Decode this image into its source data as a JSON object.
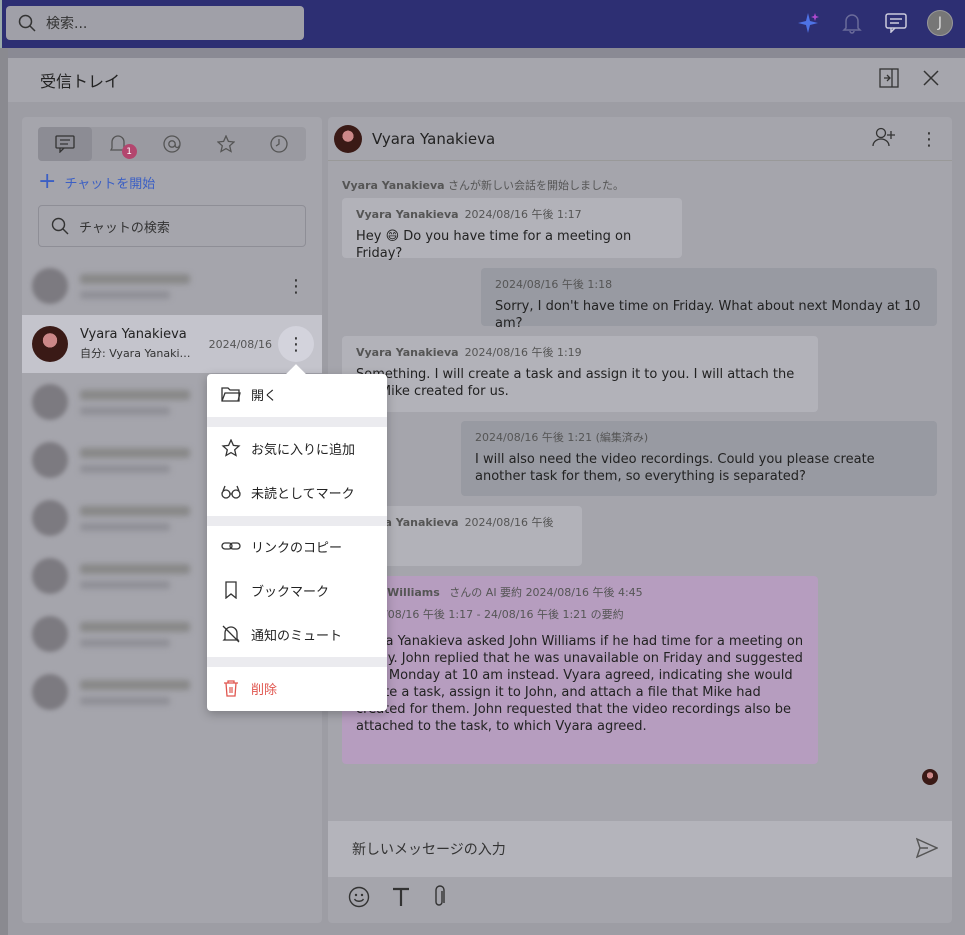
{
  "topbar": {
    "search_placeholder": "検索...",
    "avatar_letter": "J",
    "icons": [
      "sparkle-icon",
      "bell-icon",
      "chat-icon"
    ]
  },
  "panel": {
    "title": "受信トレイ"
  },
  "sidebar": {
    "tabs": [
      "chat-icon",
      "bell-icon",
      "at-icon",
      "star-icon",
      "clock-icon"
    ],
    "notif_badge": "1",
    "start_chat": "チャットを開始",
    "search_placeholder": "チャットの検索",
    "selected": {
      "name": "Vyara Yanakieva",
      "preview": "自分: Vyara Yanakieva asked…",
      "date": "2024/08/16"
    }
  },
  "context_menu": {
    "open": "開く",
    "add_favorite": "お気に入りに追加",
    "mark_unread": "未読としてマーク",
    "copy_link": "リンクのコピー",
    "bookmark": "ブックマーク",
    "mute": "通知のミュート",
    "delete": "削除"
  },
  "chat": {
    "header_name": "Vyara Yanakieva",
    "system_name": "Vyara Yanakieva",
    "system_text": " さんが新しい会話を開始しました。",
    "messages": [
      {
        "author": "Vyara Yanakieva",
        "time": "2024/08/16 午後 1:17",
        "text": "Hey 😄 Do you have time for a meeting on Friday?"
      },
      {
        "time": "2024/08/16 午後 1:18",
        "text": "Sorry, I don't have time on Friday. What about next Monday at 10 am?"
      },
      {
        "author": "Vyara Yanakieva",
        "time": "2024/08/16 午後 1:19",
        "text": "Something. I will create a task and assign it to you. I will attach the file Mike created for us."
      },
      {
        "time": "2024/08/16 午後 1:21 (編集済み)",
        "text": "I will also need the video recordings. Could you please create another task for them, so everything is separated?"
      },
      {
        "author": "Vyara Yanakieva",
        "time": "2024/08/16 午後 1:21",
        "text": "😄"
      }
    ],
    "ai_summary": {
      "author": "John Williams",
      "author_suffix": " さんの AI 要約",
      "time": "2024/08/16 午後 4:45",
      "range": "2024/08/16 午後 1:17 - 24/08/16 午後 1:21 の要約",
      "text": "Vyara Yanakieva asked John Williams if he had time for a meeting on Friday. John replied that he was unavailable on Friday and suggested next Monday at 10 am instead. Vyara agreed, indicating she would create a task, assign it to John, and attach a file that Mike had created for them. John requested that the video recordings also be attached to the task, to which Vyara agreed."
    },
    "composer_placeholder": "新しいメッセージの入力"
  }
}
